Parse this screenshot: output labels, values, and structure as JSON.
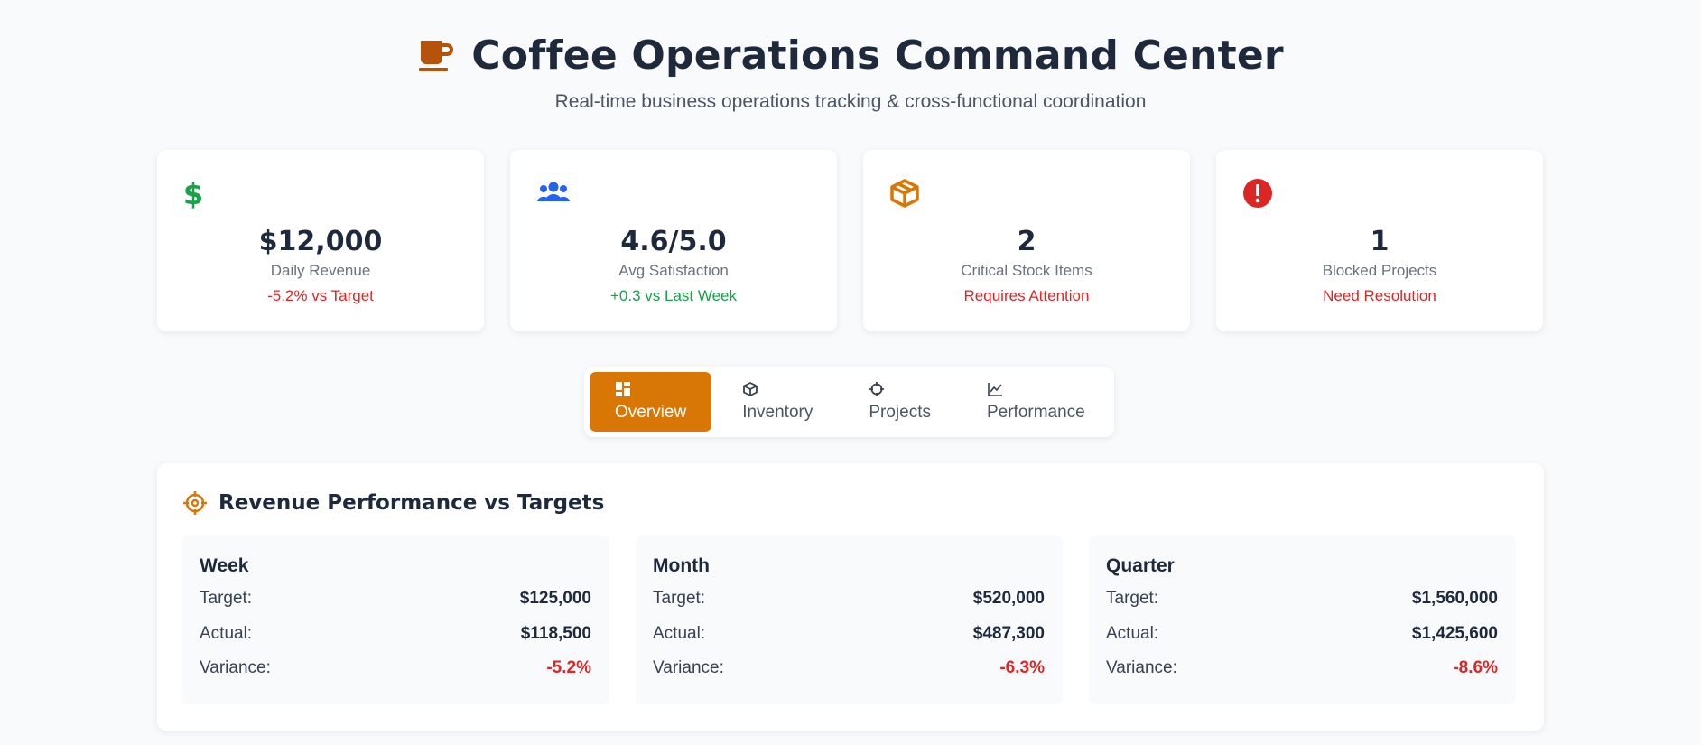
{
  "header": {
    "title": "Coffee Operations Command Center",
    "subtitle": "Real-time business operations tracking & cross-functional coordination",
    "icon": "coffee-cup-icon"
  },
  "kpis": [
    {
      "icon": "dollar-icon",
      "icon_color": "#16a34a",
      "value": "$12,000",
      "label": "Daily Revenue",
      "sub": "-5.2% vs Target",
      "sub_tone": "negative"
    },
    {
      "icon": "users-icon",
      "icon_color": "#2563eb",
      "value": "4.6/5.0",
      "label": "Avg Satisfaction",
      "sub": "+0.3 vs Last Week",
      "sub_tone": "positive"
    },
    {
      "icon": "box-icon",
      "icon_color": "#d97706",
      "value": "2",
      "label": "Critical Stock Items",
      "sub": "Requires Attention",
      "sub_tone": "negative"
    },
    {
      "icon": "alert-icon",
      "icon_color": "#dc2626",
      "value": "1",
      "label": "Blocked Projects",
      "sub": "Need Resolution",
      "sub_tone": "negative"
    }
  ],
  "tabs": [
    {
      "label": "Overview",
      "icon": "grid-icon",
      "active": true
    },
    {
      "label": "Inventory",
      "icon": "box-icon",
      "active": false
    },
    {
      "label": "Projects",
      "icon": "target-icon",
      "active": false
    },
    {
      "label": "Performance",
      "icon": "chart-line-icon",
      "active": false
    }
  ],
  "revenue": {
    "title": "Revenue Performance vs Targets",
    "icon": "target-icon",
    "target_label": "Target:",
    "actual_label": "Actual:",
    "variance_label": "Variance:",
    "periods": [
      {
        "name": "Week",
        "target": "$125,000",
        "actual": "$118,500",
        "variance": "-5.2%"
      },
      {
        "name": "Month",
        "target": "$520,000",
        "actual": "$487,300",
        "variance": "-6.3%"
      },
      {
        "name": "Quarter",
        "target": "$1,560,000",
        "actual": "$1,425,600",
        "variance": "-8.6%"
      }
    ]
  },
  "colors": {
    "accent": "#d97706",
    "negative": "#dc2626",
    "positive": "#16a34a",
    "background": "#f8fafc"
  }
}
